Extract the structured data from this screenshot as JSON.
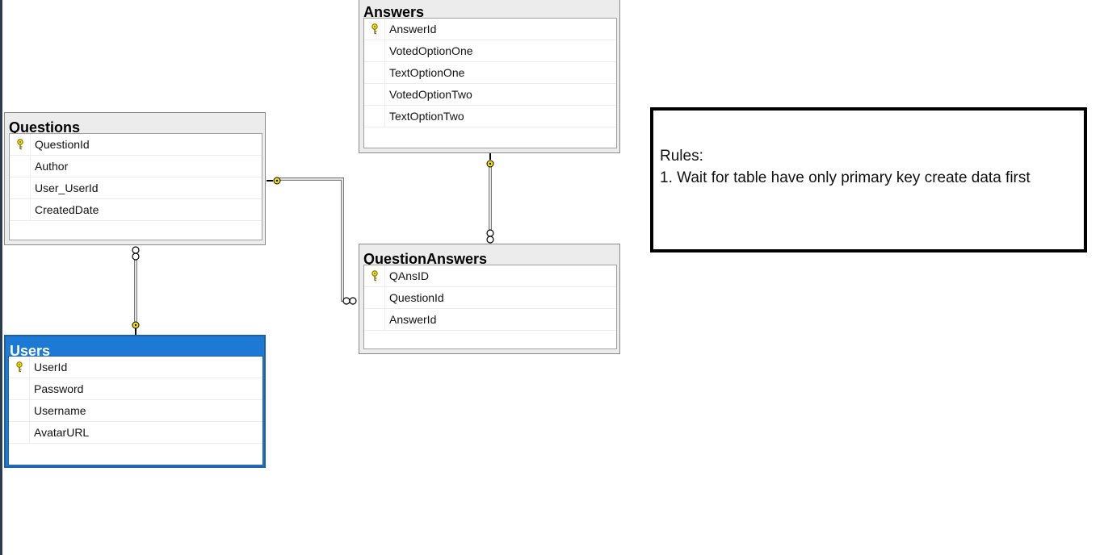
{
  "tables": {
    "answers": {
      "title": "Answers",
      "columns": [
        "AnswerId",
        "VotedOptionOne",
        "TextOptionOne",
        "VotedOptionTwo",
        "TextOptionTwo"
      ],
      "primary_key": "AnswerId"
    },
    "questions": {
      "title": "Questions",
      "columns": [
        "QuestionId",
        "Author",
        "User_UserId",
        "CreatedDate"
      ],
      "primary_key": "QuestionId"
    },
    "question_answers": {
      "title": "QuestionAnswers",
      "columns": [
        "QAnsID",
        "QuestionId",
        "AnswerId"
      ],
      "primary_key": "QAnsID"
    },
    "users": {
      "title": "Users",
      "columns": [
        "UserId",
        "Password",
        "Username",
        "AvatarURL"
      ],
      "primary_key": "UserId",
      "selected": true
    }
  },
  "note": {
    "heading": "Rules:",
    "rule_1": "1. Wait for table have only primary key create data first"
  },
  "colors": {
    "selection_blue": "#1c7ad4",
    "key_yellow": "#f5e400",
    "table_frame": "#ececec"
  },
  "icons": {
    "primary_key": "key-icon",
    "relationship_one_end": "key-icon",
    "relationship_many_end": "infinity-icon"
  }
}
